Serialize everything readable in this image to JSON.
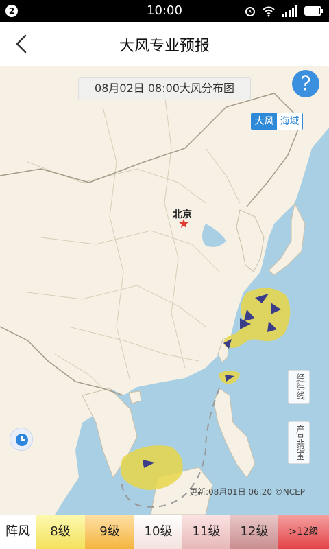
{
  "status_bar": {
    "notification_count": "2",
    "time": "10:00"
  },
  "header": {
    "title": "大风专业预报"
  },
  "map": {
    "title": "08月02日 08:00大风分布图",
    "toggle": {
      "active": "大风",
      "inactive": "海域"
    },
    "side_buttons": {
      "grid": "经纬线",
      "range": "产品范围"
    },
    "city": "北京",
    "credit": "更新:08月01日 06:20 ©NCEP",
    "help_label": "?"
  },
  "legend": {
    "label": "阵风",
    "levels": [
      "8级",
      "9级",
      "10级",
      "11级",
      "12级",
      ">12级"
    ]
  },
  "colors": {
    "accent": "#2e8ad8",
    "wind_zone": "#e8d64a",
    "land": "#f6f1e4",
    "sea": "#a9cfe4"
  }
}
